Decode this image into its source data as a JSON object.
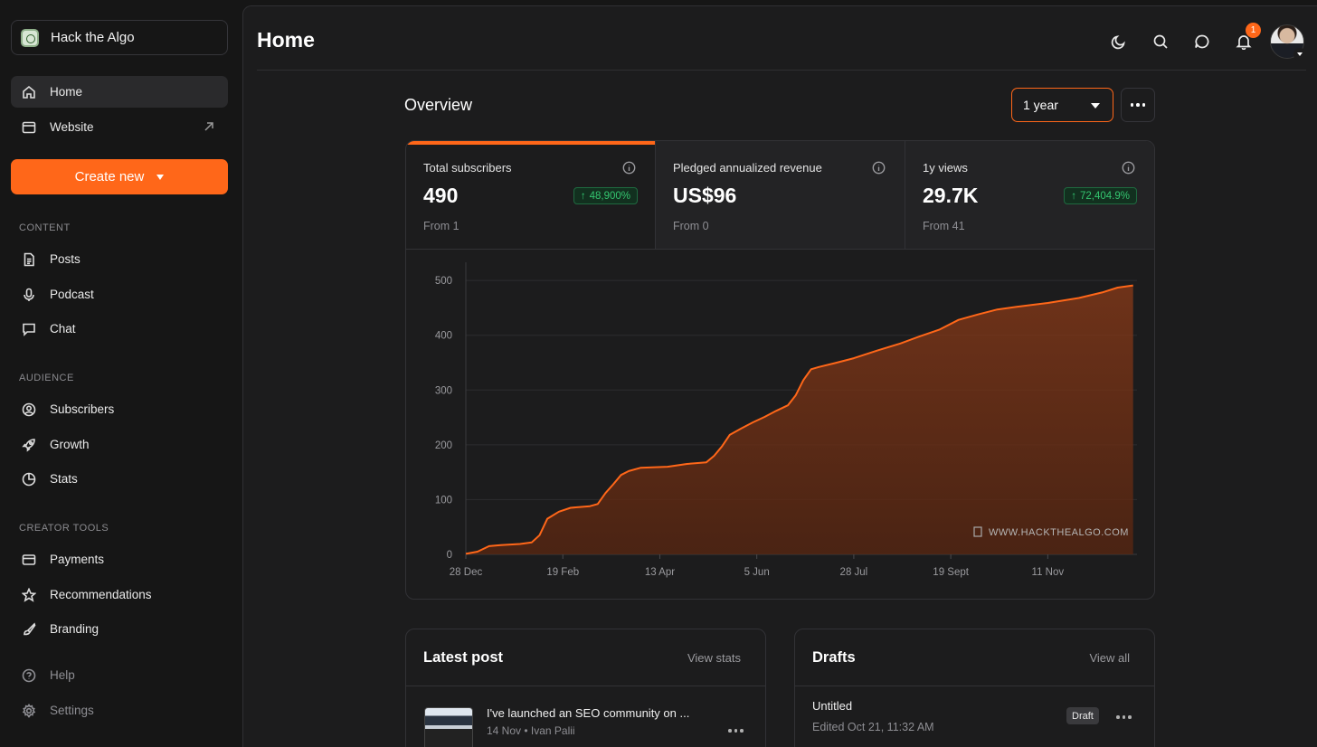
{
  "sidebar": {
    "publication_name": "Hack the Algo",
    "nav_top": [
      {
        "label": "Home",
        "icon": "home-icon"
      },
      {
        "label": "Website",
        "icon": "browser-window-icon"
      }
    ],
    "create_label": "Create new",
    "sections": [
      {
        "label": "CONTENT",
        "items": [
          {
            "label": "Posts",
            "icon": "document-icon"
          },
          {
            "label": "Podcast",
            "icon": "microphone-icon"
          },
          {
            "label": "Chat",
            "icon": "chat-bubble-icon"
          }
        ]
      },
      {
        "label": "AUDIENCE",
        "items": [
          {
            "label": "Subscribers",
            "icon": "user-circle-icon"
          },
          {
            "label": "Growth",
            "icon": "rocket-icon"
          },
          {
            "label": "Stats",
            "icon": "pie-chart-icon"
          }
        ]
      },
      {
        "label": "CREATOR TOOLS",
        "items": [
          {
            "label": "Payments",
            "icon": "credit-card-icon"
          },
          {
            "label": "Recommendations",
            "icon": "star-icon"
          },
          {
            "label": "Branding",
            "icon": "paintbrush-icon"
          }
        ]
      }
    ],
    "footer": [
      {
        "label": "Help",
        "icon": "help-circle-icon"
      },
      {
        "label": "Settings",
        "icon": "gear-icon"
      }
    ]
  },
  "header": {
    "title": "Home",
    "notification_count": "1",
    "icons": [
      "moon-icon",
      "search-icon",
      "chat-icon",
      "bell-icon"
    ]
  },
  "overview": {
    "title": "Overview",
    "range": "1 year",
    "metrics": [
      {
        "label": "Total subscribers",
        "value": "490",
        "from": "From 1",
        "change": "48,900%"
      },
      {
        "label": "Pledged annualized revenue",
        "value": "US$96",
        "from": "From 0",
        "change": ""
      },
      {
        "label": "1y views",
        "value": "29.7K",
        "from": "From 41",
        "change": "72,404.9%"
      }
    ],
    "watermark": "WWW.HACKTHEALGO.COM"
  },
  "chart_data": {
    "type": "area",
    "x_tick_labels": [
      "28 Dec",
      "19 Feb",
      "13 Apr",
      "5 Jun",
      "28 Jul",
      "19 Sept",
      "11 Nov"
    ],
    "y_ticks": [
      0,
      100,
      200,
      300,
      400,
      500
    ],
    "ylim": [
      0,
      520
    ],
    "grid": true,
    "color": "#ff6719",
    "series": [
      {
        "points": [
          [
            0,
            1
          ],
          [
            3,
            5
          ],
          [
            6,
            15
          ],
          [
            9,
            17
          ],
          [
            14,
            19
          ],
          [
            17,
            22
          ],
          [
            19,
            35
          ],
          [
            21,
            65
          ],
          [
            24,
            78
          ],
          [
            27,
            85
          ],
          [
            32,
            88
          ],
          [
            34,
            92
          ],
          [
            36,
            112
          ],
          [
            38,
            128
          ],
          [
            40,
            145
          ],
          [
            42,
            152
          ],
          [
            45,
            158
          ],
          [
            52,
            160
          ],
          [
            57,
            165
          ],
          [
            62,
            168
          ],
          [
            64,
            180
          ],
          [
            66,
            197
          ],
          [
            68,
            218
          ],
          [
            71,
            230
          ],
          [
            74,
            241
          ],
          [
            77,
            251
          ],
          [
            80,
            262
          ],
          [
            83,
            272
          ],
          [
            85,
            290
          ],
          [
            87,
            318
          ],
          [
            89,
            338
          ],
          [
            91,
            342
          ],
          [
            95,
            349
          ],
          [
            100,
            358
          ],
          [
            106,
            372
          ],
          [
            112,
            385
          ],
          [
            117,
            398
          ],
          [
            122,
            410
          ],
          [
            127,
            428
          ],
          [
            132,
            438
          ],
          [
            137,
            447
          ],
          [
            142,
            452
          ],
          [
            150,
            459
          ],
          [
            158,
            468
          ],
          [
            164,
            478
          ],
          [
            168,
            487
          ],
          [
            172,
            491
          ]
        ],
        "x_unit": "days since 28 Dec"
      }
    ]
  },
  "latest_post": {
    "title": "Latest post",
    "link": "View stats",
    "post_title": "I've launched an SEO community on ...",
    "post_meta": "14 Nov • Ivan Palii"
  },
  "drafts": {
    "title": "Drafts",
    "link": "View all",
    "draft_title": "Untitled",
    "draft_meta": "Edited Oct 21, 11:32 AM",
    "badge": "Draft"
  }
}
